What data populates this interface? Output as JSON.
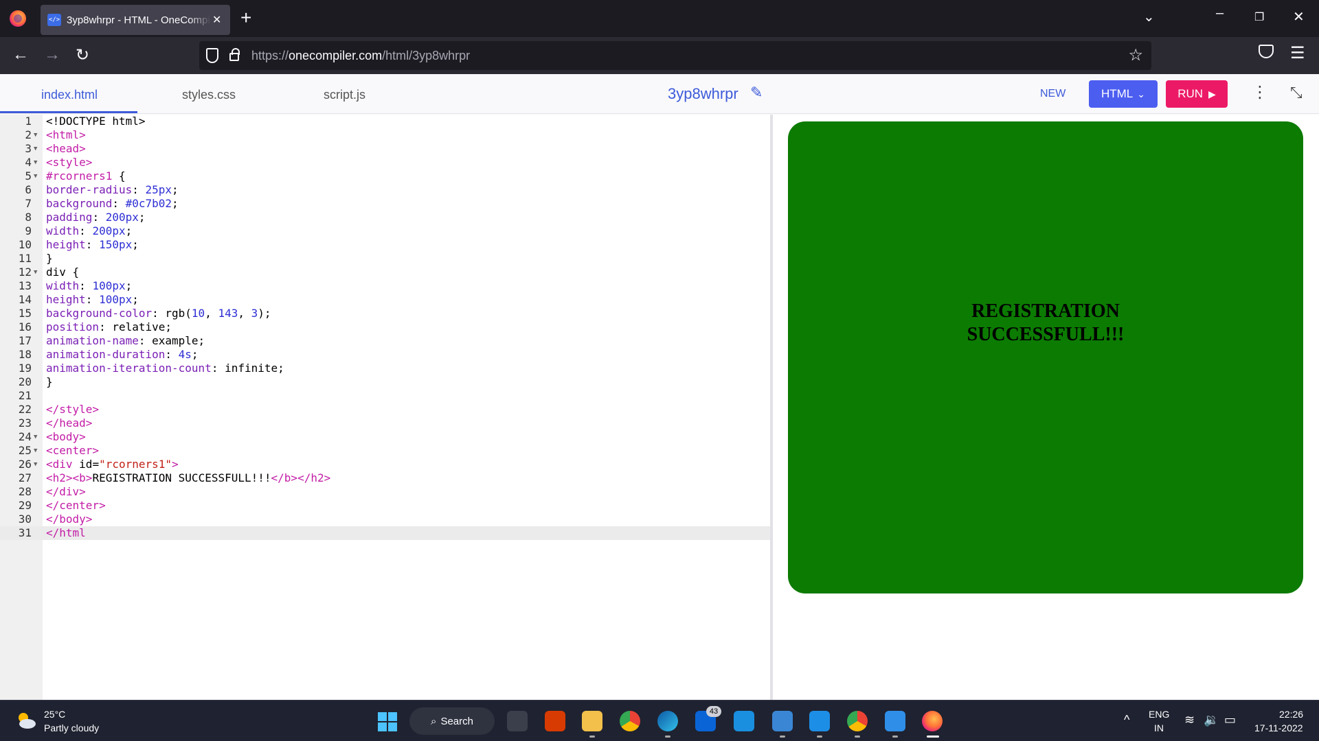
{
  "browser": {
    "tab_title": "3yp8whrpr - HTML - OneCompiler",
    "tab_favicon": "</>",
    "url_prefix": "https://",
    "url_domain": "onecompiler.com",
    "url_path": "/html/3yp8whrpr"
  },
  "app": {
    "file_tabs": [
      "index.html",
      "styles.css",
      "script.js"
    ],
    "active_tab": "index.html",
    "project_title": "3yp8whrpr",
    "new_label": "NEW",
    "language_label": "HTML",
    "run_label": "RUN"
  },
  "editor": {
    "active_line": 31,
    "lines": [
      {
        "n": "1",
        "fold": false,
        "segments": [
          [
            "",
            "<!DOCTYPE html>"
          ]
        ]
      },
      {
        "n": "2",
        "fold": true,
        "segments": [
          [
            "t",
            "<html>"
          ]
        ]
      },
      {
        "n": "3",
        "fold": true,
        "segments": [
          [
            "t",
            "<head>"
          ]
        ]
      },
      {
        "n": "4",
        "fold": true,
        "segments": [
          [
            "t",
            "<style>"
          ]
        ]
      },
      {
        "n": "5",
        "fold": true,
        "segments": [
          [
            "t",
            "#rcorners1"
          ],
          [
            "",
            " {"
          ]
        ]
      },
      {
        "n": "6",
        "fold": false,
        "segments": [
          [
            "p",
            "border-radius"
          ],
          [
            "",
            ": "
          ],
          [
            "n",
            "25px"
          ],
          [
            "",
            ";"
          ]
        ]
      },
      {
        "n": "7",
        "fold": false,
        "segments": [
          [
            "p",
            "background"
          ],
          [
            "",
            ": "
          ],
          [
            "n",
            "#0c7b02"
          ],
          [
            "",
            ";"
          ]
        ]
      },
      {
        "n": "8",
        "fold": false,
        "segments": [
          [
            "p",
            "padding"
          ],
          [
            "",
            ": "
          ],
          [
            "n",
            "200px"
          ],
          [
            "",
            ";"
          ]
        ]
      },
      {
        "n": "9",
        "fold": false,
        "segments": [
          [
            "p",
            "width"
          ],
          [
            "",
            ": "
          ],
          [
            "n",
            "200px"
          ],
          [
            "",
            ";"
          ]
        ]
      },
      {
        "n": "10",
        "fold": false,
        "segments": [
          [
            "p",
            "height"
          ],
          [
            "",
            ": "
          ],
          [
            "n",
            "150px"
          ],
          [
            "",
            ";"
          ]
        ]
      },
      {
        "n": "11",
        "fold": false,
        "segments": [
          [
            "",
            "}"
          ]
        ]
      },
      {
        "n": "12",
        "fold": true,
        "segments": [
          [
            "",
            "div {"
          ]
        ]
      },
      {
        "n": "13",
        "fold": false,
        "segments": [
          [
            "p",
            "width"
          ],
          [
            "",
            ": "
          ],
          [
            "n",
            "100px"
          ],
          [
            "",
            ";"
          ]
        ]
      },
      {
        "n": "14",
        "fold": false,
        "segments": [
          [
            "p",
            "height"
          ],
          [
            "",
            ": "
          ],
          [
            "n",
            "100px"
          ],
          [
            "",
            ";"
          ]
        ]
      },
      {
        "n": "15",
        "fold": false,
        "segments": [
          [
            "p",
            "background-color"
          ],
          [
            "",
            ": rgb("
          ],
          [
            "n",
            "10"
          ],
          [
            "",
            ", "
          ],
          [
            "n",
            "143"
          ],
          [
            "",
            ", "
          ],
          [
            "n",
            "3"
          ],
          [
            "",
            ");"
          ]
        ]
      },
      {
        "n": "16",
        "fold": false,
        "segments": [
          [
            "p",
            "position"
          ],
          [
            "",
            ": relative;"
          ]
        ]
      },
      {
        "n": "17",
        "fold": false,
        "segments": [
          [
            "p",
            "animation-name"
          ],
          [
            "",
            ": example;"
          ]
        ]
      },
      {
        "n": "18",
        "fold": false,
        "segments": [
          [
            "p",
            "animation-duration"
          ],
          [
            "",
            ": "
          ],
          [
            "n",
            "4s"
          ],
          [
            "",
            ";"
          ]
        ]
      },
      {
        "n": "19",
        "fold": false,
        "segments": [
          [
            "p",
            "animation-iteration-count"
          ],
          [
            "",
            ": infinite;"
          ]
        ]
      },
      {
        "n": "20",
        "fold": false,
        "segments": [
          [
            "",
            "}"
          ]
        ]
      },
      {
        "n": "21",
        "fold": false,
        "segments": []
      },
      {
        "n": "22",
        "fold": false,
        "segments": [
          [
            "t",
            "</style>"
          ]
        ]
      },
      {
        "n": "23",
        "fold": false,
        "segments": [
          [
            "t",
            "</head>"
          ]
        ]
      },
      {
        "n": "24",
        "fold": true,
        "segments": [
          [
            "t",
            "<body>"
          ]
        ]
      },
      {
        "n": "25",
        "fold": true,
        "segments": [
          [
            "t",
            "<center>"
          ]
        ]
      },
      {
        "n": "26",
        "fold": true,
        "segments": [
          [
            "t",
            "<div "
          ],
          [
            "",
            "id="
          ],
          [
            "s",
            "\"rcorners1\""
          ],
          [
            "t",
            ">"
          ]
        ]
      },
      {
        "n": "27",
        "fold": false,
        "segments": [
          [
            "t",
            "<h2><b>"
          ],
          [
            "",
            "REGISTRATION SUCCESSFULL!!!"
          ],
          [
            "t",
            "</b></h2>"
          ]
        ]
      },
      {
        "n": "28",
        "fold": false,
        "segments": [
          [
            "t",
            "</div>"
          ]
        ]
      },
      {
        "n": "29",
        "fold": false,
        "segments": [
          [
            "t",
            "</center>"
          ]
        ]
      },
      {
        "n": "30",
        "fold": false,
        "segments": [
          [
            "t",
            "</body>"
          ]
        ]
      },
      {
        "n": "31",
        "fold": false,
        "segments": [
          [
            "t",
            "</html"
          ]
        ]
      }
    ]
  },
  "output": {
    "box_color": "#0c7b02",
    "text": "REGISTRATION SUCCESSFULL!!!"
  },
  "taskbar": {
    "temperature": "25°C",
    "weather": "Partly cloudy",
    "search_label": "Search",
    "mail_badge": "43",
    "lang_line1": "ENG",
    "lang_line2": "IN",
    "time": "22:26",
    "date": "17-11-2022"
  },
  "colors": {
    "accent": "#3d5bd9",
    "html_button": "#4c5ef0",
    "run_button": "#ec1a66"
  }
}
